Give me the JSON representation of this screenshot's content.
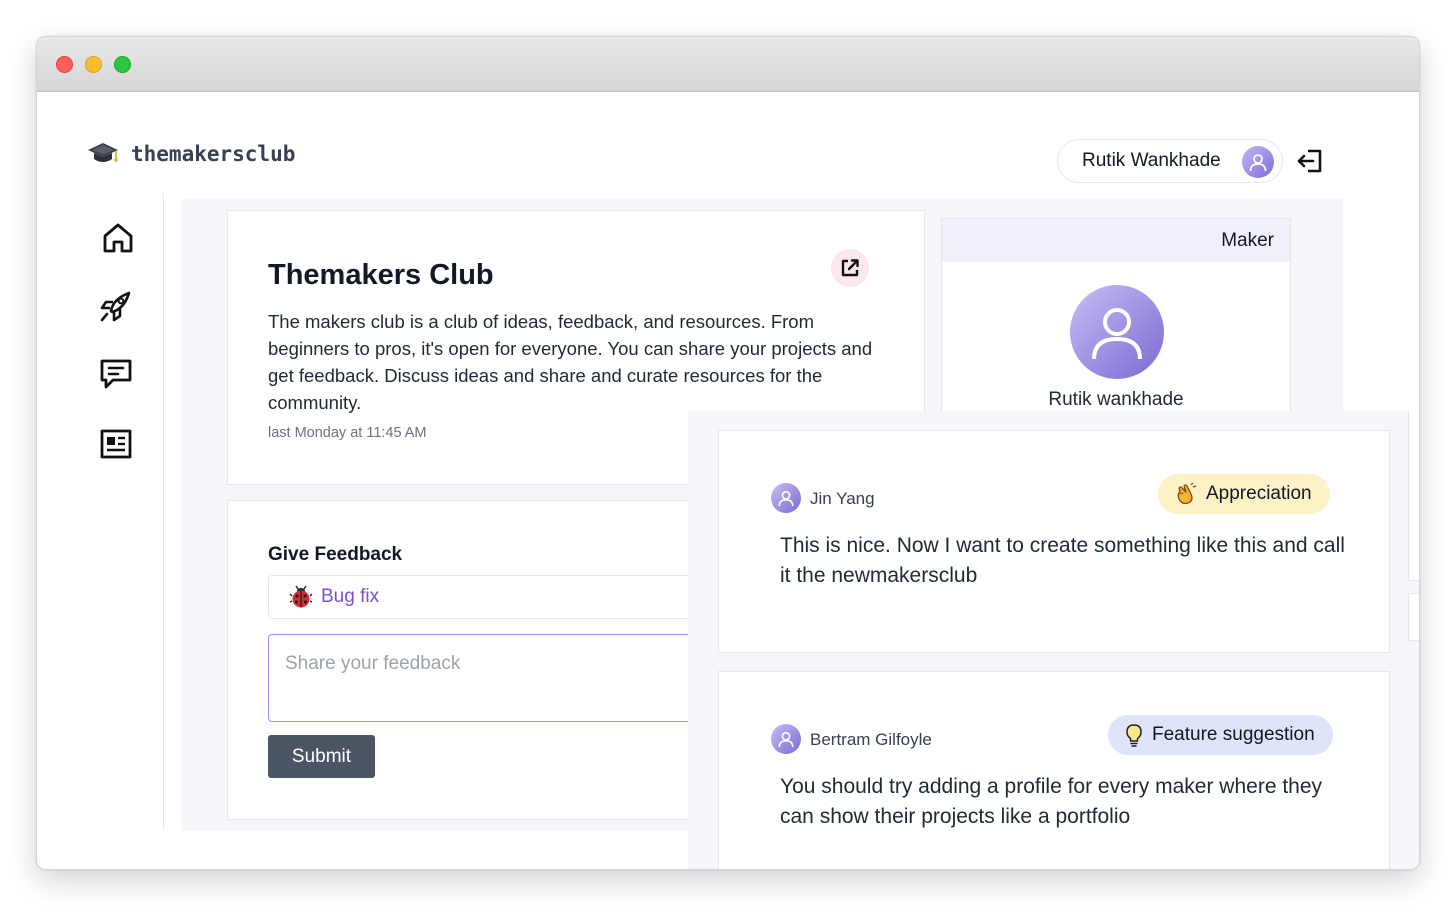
{
  "app": {
    "logo_text": "themakersclub"
  },
  "header": {
    "user_name": "Rutik Wankhade"
  },
  "club": {
    "title": "Themakers Club",
    "description": "The makers club is a club of ideas, feedback, and resources. From beginners to pros, it's open for everyone. You can share your projects and get feedback. Discuss ideas and share and curate resources for the community.",
    "timestamp": "last Monday at 11:45 AM"
  },
  "maker": {
    "label": "Maker",
    "name": "Rutik wankhade"
  },
  "feedback_form": {
    "label": "Give Feedback",
    "selected_type": "Bug fix",
    "placeholder": "Share your feedback",
    "submit_label": "Submit"
  },
  "comments": [
    {
      "author": "Jin Yang",
      "badge": "Appreciation",
      "badge_icon": "clapping-hands-icon",
      "badge_color": "#fdf1c6",
      "text": "This is nice. Now I want to create something like this and call it the newmakersclub"
    },
    {
      "author": "Bertram Gilfoyle",
      "badge": "Feature suggestion",
      "badge_icon": "lightbulb-icon",
      "badge_color": "#dfe4fb",
      "text": "You should try adding a profile for every maker where they can show their projects like a portfolio"
    }
  ],
  "colors": {
    "accent_purple": "#7c4fd6",
    "submit_bg": "#4b5563",
    "maker_header_bg": "#f1f0fb",
    "link_bg": "#fce7ef"
  }
}
